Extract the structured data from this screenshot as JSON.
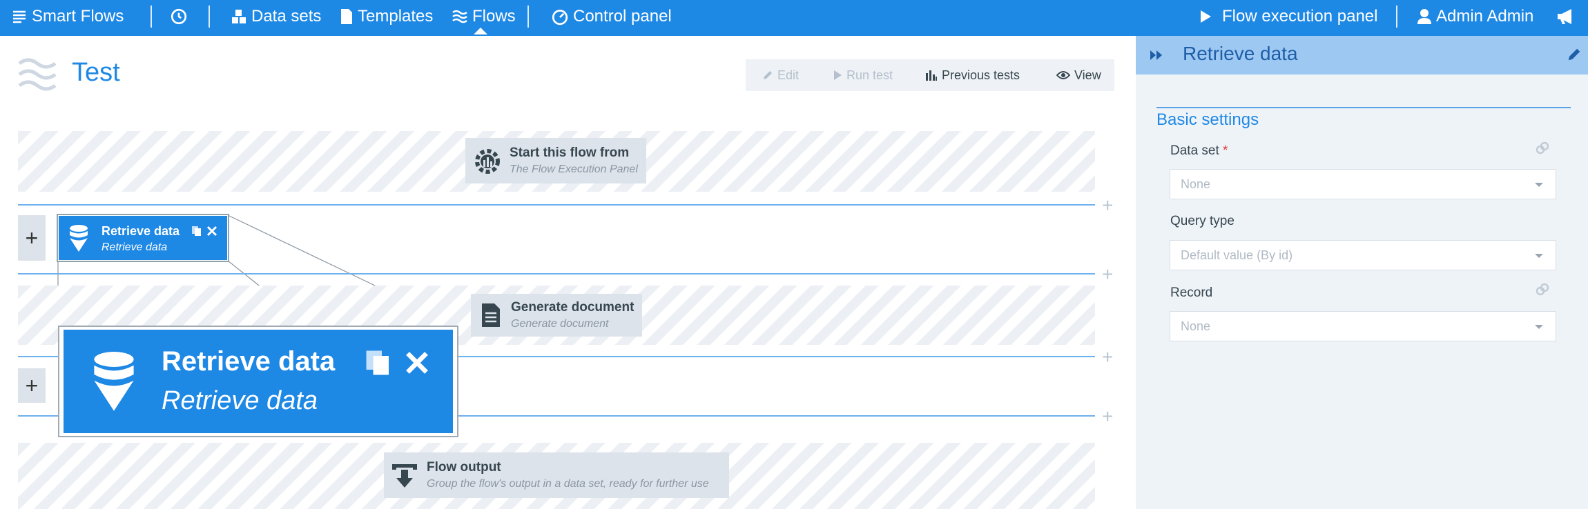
{
  "nav": {
    "brand": "Smart Flows",
    "history_icon": "history-clock-icon",
    "items": [
      {
        "label": "Data sets",
        "icon": "cubes-icon"
      },
      {
        "label": "Templates",
        "icon": "document-icon"
      },
      {
        "label": "Flows",
        "icon": "waves-icon",
        "active": true
      },
      {
        "label": "Control panel",
        "icon": "gauge-icon"
      }
    ],
    "execution_panel": "Flow execution panel",
    "user": "Admin Admin"
  },
  "page": {
    "title": "Test",
    "toolbar": {
      "edit": "Edit",
      "run_test": "Run test",
      "previous_tests": "Previous tests",
      "view": "View"
    }
  },
  "canvas": {
    "start": {
      "title": "Start this flow from",
      "subtitle": "The Flow Execution Panel"
    },
    "retrieve": {
      "title": "Retrieve data",
      "subtitle": "Retrieve data"
    },
    "generate": {
      "title": "Generate document",
      "subtitle": "Generate document"
    },
    "output": {
      "title": "Flow output",
      "subtitle": "Group the flow's output in a data set, ready for further use"
    },
    "zoom": {
      "title": "Retrieve data",
      "subtitle": "Retrieve data"
    },
    "plus": "+"
  },
  "panel": {
    "title": "Retrieve data",
    "section": "Basic settings",
    "fields": {
      "dataset": {
        "label": "Data set",
        "required": "*",
        "value": "None"
      },
      "query_type": {
        "label": "Query type",
        "value": "Default value (By id)"
      },
      "record": {
        "label": "Record",
        "value": "None"
      }
    }
  },
  "colors": {
    "accent": "#1e88e5",
    "panel_header": "#9dc8f2",
    "required": "#e53935"
  }
}
